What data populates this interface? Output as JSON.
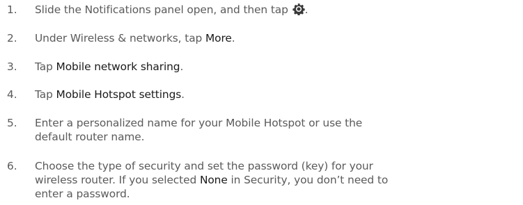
{
  "steps": [
    {
      "number": "1.",
      "text_before": "Slide the Notifications panel open, and then tap ",
      "icon": "settings-gear-icon",
      "text_after": "."
    },
    {
      "number": "2.",
      "text_before": "Under Wireless & networks, tap ",
      "highlight": "More",
      "text_after": "."
    },
    {
      "number": "3.",
      "text_before": "Tap ",
      "highlight": "Mobile network sharing",
      "text_after": "."
    },
    {
      "number": "4.",
      "text_before": "Tap ",
      "highlight": "Mobile Hotspot settings",
      "text_after": "."
    },
    {
      "number": "5.",
      "line1": "Enter a personalized name for your Mobile Hotspot or use the",
      "line2": "default router name."
    },
    {
      "number": "6.",
      "line1": "Choose the type of security and set the password (key) for your",
      "line2_before": "wireless router. If you selected ",
      "line2_highlight": "None",
      "line2_after": " in Security, you don’t need to",
      "line3": "enter a password."
    }
  ],
  "colors": {
    "body_text": "#5a5a5a",
    "highlight_text": "#1a1a1a"
  }
}
